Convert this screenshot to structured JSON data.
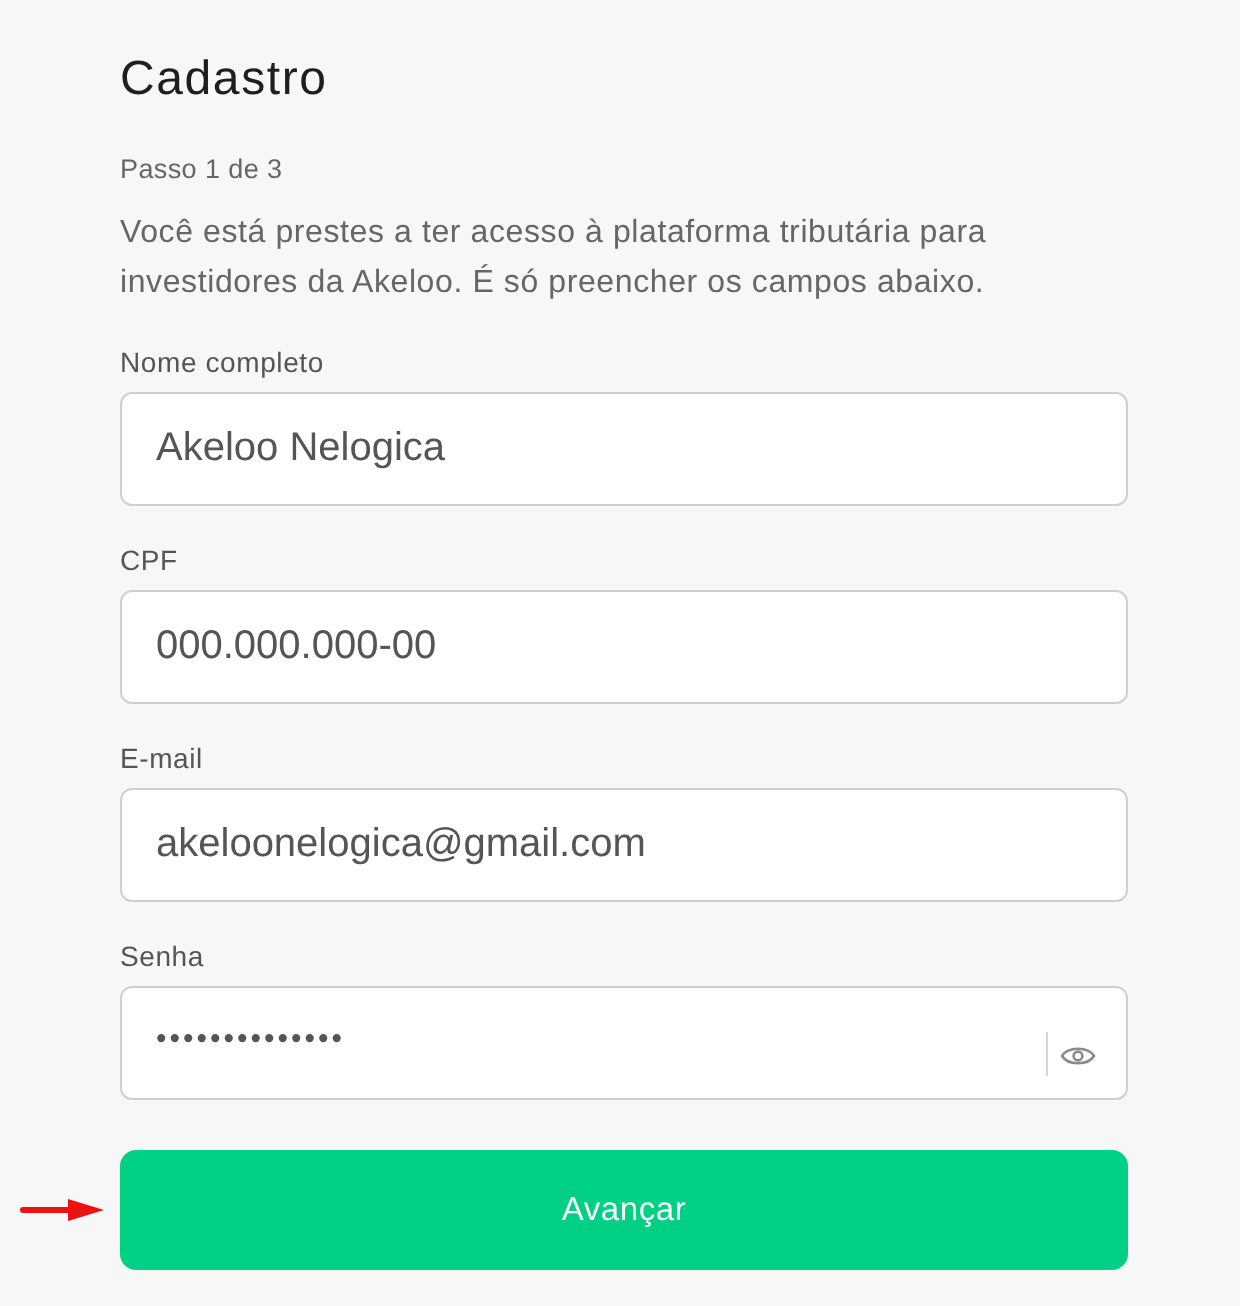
{
  "title": "Cadastro",
  "step": "Passo 1 de 3",
  "intro": "Você está prestes a ter acesso à plataforma tributária para investidores da Akeloo. É só preencher os campos abaixo.",
  "fields": [
    {
      "label": "Nome completo",
      "value": "Akeloo Nelogica",
      "kind": "text"
    },
    {
      "label": "CPF",
      "value": "000.000.000-00",
      "kind": "text"
    },
    {
      "label": "E-mail",
      "value": "akeloonelogica@gmail.com",
      "kind": "text"
    },
    {
      "label": "Senha",
      "value": "••••••••••••••",
      "kind": "password"
    }
  ],
  "submit_button": "Avançar"
}
